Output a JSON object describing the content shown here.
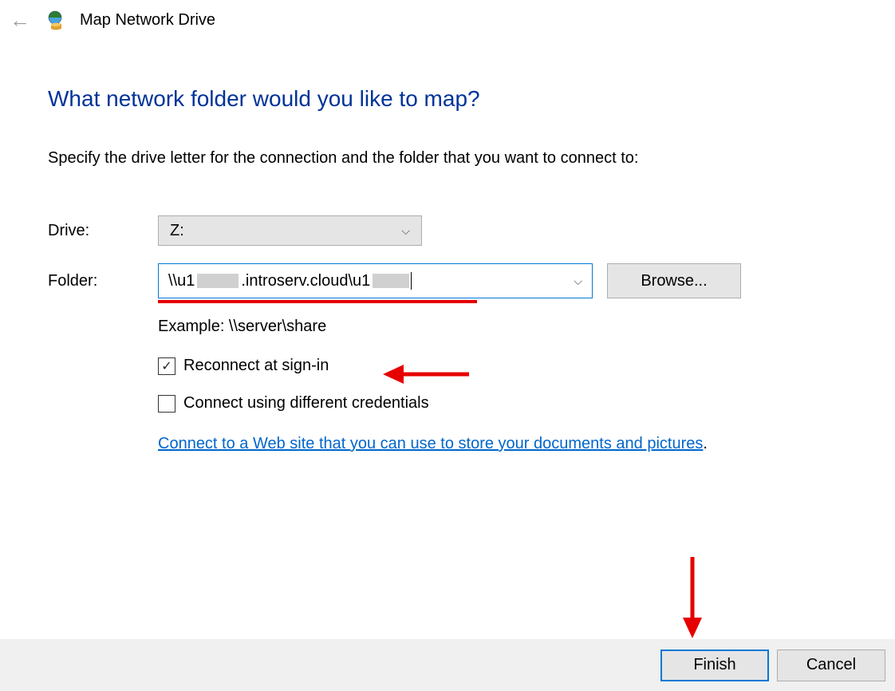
{
  "header": {
    "title": "Map Network Drive"
  },
  "main": {
    "question": "What network folder would you like to map?",
    "instruction": "Specify the drive letter for the connection and the folder that you want to connect to:",
    "drive_label": "Drive:",
    "drive_value": "Z:",
    "folder_label": "Folder:",
    "folder_value_prefix": "\\\\u1",
    "folder_value_mid": ".introserv.cloud\\u1",
    "browse_label": "Browse...",
    "example": "Example: \\\\server\\share",
    "reconnect_checked": true,
    "reconnect_label": "Reconnect at sign-in",
    "alt_creds_checked": false,
    "alt_creds_label": "Connect using different credentials",
    "link_text": "Connect to a Web site that you can use to store your documents and pictures"
  },
  "footer": {
    "finish_label": "Finish",
    "cancel_label": "Cancel"
  }
}
